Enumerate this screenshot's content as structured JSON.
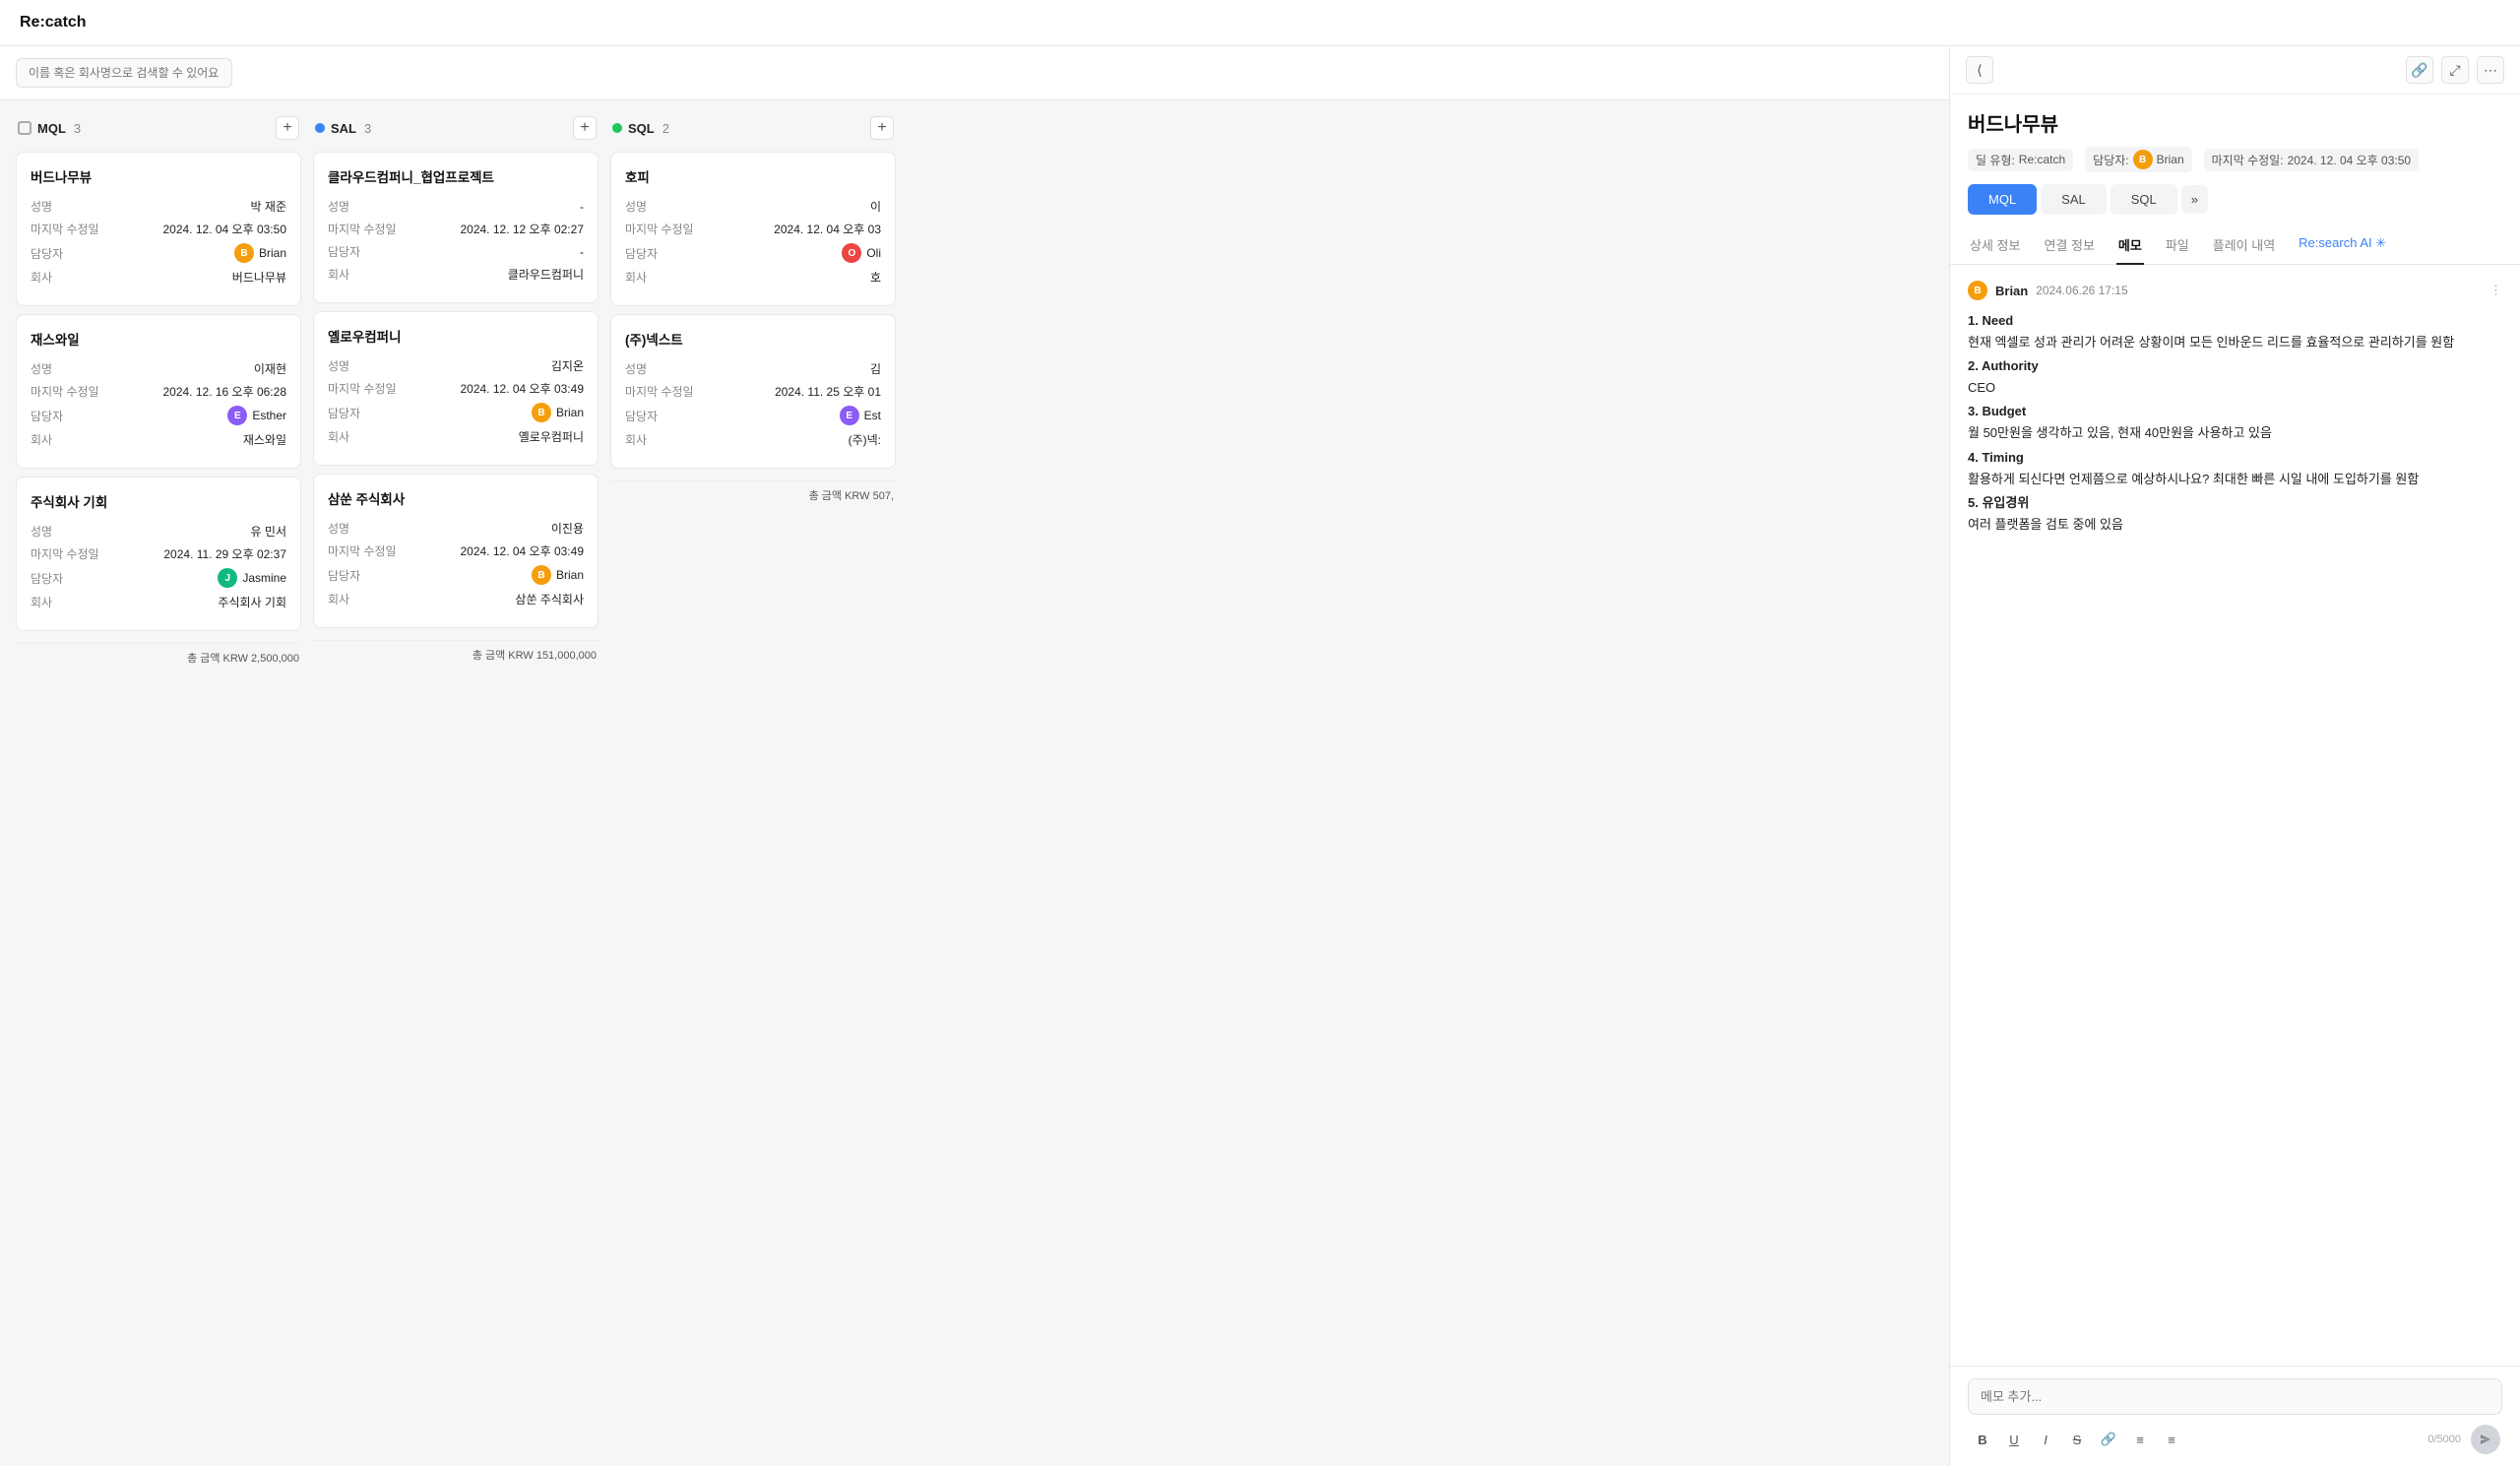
{
  "app": {
    "title": "Re:catch"
  },
  "search": {
    "placeholder": "이름 혹은 회사명으로 검색할 수 있어요."
  },
  "columns": [
    {
      "id": "mql",
      "label": "MQL",
      "count": 3,
      "dot_type": "outline",
      "total_label": "총 금액",
      "total": "KRW 2,500,000",
      "cards": [
        {
          "title": "버드나무뷰",
          "name_label": "성명",
          "name_value": "박 재준",
          "modified_label": "마지막 수정일",
          "modified_value": "2024. 12. 04 오후 03:50",
          "assignee_label": "담당자",
          "assignee_name": "Brian",
          "assignee_avatar": "B",
          "assignee_class": "av-brian",
          "company_label": "회사",
          "company_value": "버드나무뷰"
        },
        {
          "title": "재스와일",
          "name_label": "성명",
          "name_value": "이재현",
          "modified_label": "마지막 수정일",
          "modified_value": "2024. 12. 16 오후 06:28",
          "assignee_label": "담당자",
          "assignee_name": "Esther",
          "assignee_avatar": "E",
          "assignee_class": "av-esther",
          "company_label": "회사",
          "company_value": "재스와일"
        },
        {
          "title": "주식회사 기회",
          "name_label": "성명",
          "name_value": "유 민서",
          "modified_label": "마지막 수정일",
          "modified_value": "2024. 11. 29 오후 02:37",
          "assignee_label": "담당자",
          "assignee_name": "Jasmine",
          "assignee_avatar": "J",
          "assignee_class": "av-jasmine",
          "company_label": "회사",
          "company_value": "주식회사 기회"
        }
      ]
    },
    {
      "id": "sal",
      "label": "SAL",
      "count": 3,
      "dot_type": "blue",
      "total_label": "총 금액",
      "total": "KRW 151,000,000",
      "cards": [
        {
          "title": "클라우드컴퍼니_협업프로젝트",
          "name_label": "성명",
          "name_value": "-",
          "modified_label": "마지막 수정일",
          "modified_value": "2024. 12. 12 오후 02:27",
          "assignee_label": "담당자",
          "assignee_name": "-",
          "assignee_avatar": "",
          "assignee_class": "",
          "company_label": "회사",
          "company_value": "클라우드컴퍼니"
        },
        {
          "title": "옐로우컴퍼니",
          "name_label": "성명",
          "name_value": "김지온",
          "modified_label": "마지막 수정일",
          "modified_value": "2024. 12. 04 오후 03:49",
          "assignee_label": "담당자",
          "assignee_name": "Brian",
          "assignee_avatar": "B",
          "assignee_class": "av-brian",
          "company_label": "회사",
          "company_value": "옐로우컴퍼니"
        },
        {
          "title": "삼쑨 주식회사",
          "name_label": "성명",
          "name_value": "이진용",
          "modified_label": "마지막 수정일",
          "modified_value": "2024. 12. 04 오후 03:49",
          "assignee_label": "담당자",
          "assignee_name": "Brian",
          "assignee_avatar": "B",
          "assignee_class": "av-brian",
          "company_label": "회사",
          "company_value": "삼쑨 주식회사"
        }
      ]
    },
    {
      "id": "sql",
      "label": "SQL",
      "count": 2,
      "dot_type": "green",
      "total_label": "총 금액",
      "total": "KRW 507,",
      "cards": [
        {
          "title": "호피",
          "name_label": "성명",
          "name_value": "이",
          "modified_label": "마지막 수정일",
          "modified_value": "2024. 12. 04 오후 03",
          "assignee_label": "담당자",
          "assignee_name": "Oli",
          "assignee_avatar": "O",
          "assignee_class": "av-oli",
          "company_label": "회사",
          "company_value": "호"
        },
        {
          "title": "(주)넥스트",
          "name_label": "성명",
          "name_value": "김",
          "modified_label": "마지막 수정일",
          "modified_value": "2024. 11. 25 오후 01",
          "assignee_label": "담당자",
          "assignee_name": "Est",
          "assignee_avatar": "E",
          "assignee_class": "av-est",
          "company_label": "회사",
          "company_value": "(주)넥:"
        }
      ]
    }
  ],
  "detail": {
    "title": "버드나무뷰",
    "meta": {
      "deal_type_label": "딜 유형:",
      "deal_type_value": "Re:catch",
      "assignee_label": "담당자:",
      "assignee_name": "Brian",
      "assignee_avatar": "B",
      "modified_label": "마지막 수정일:",
      "modified_value": "2024. 12. 04 오후 03:50"
    },
    "stage_tabs": [
      {
        "label": "MQL",
        "active": true
      },
      {
        "label": "SAL",
        "active": false
      },
      {
        "label": "SQL",
        "active": false
      }
    ],
    "stage_more": "»",
    "nav_tabs": [
      {
        "label": "상세 정보",
        "active": false
      },
      {
        "label": "연결 정보",
        "active": false
      },
      {
        "label": "메모",
        "active": true
      },
      {
        "label": "파일",
        "active": false
      },
      {
        "label": "플레이 내역",
        "active": false
      },
      {
        "label": "Re:search AI ✳",
        "active": false,
        "special": true
      }
    ],
    "memo": {
      "author": "Brian",
      "author_avatar": "B",
      "timestamp": "2024.06.26  17:15",
      "content": [
        {
          "section": "1. Need",
          "text": "현재 엑셀로 성과 관리가 어려운 상황이며 모든 인바운드 리드를 효율적으로 관리하기를 원함"
        },
        {
          "section": "2. Authority",
          "text": "CEO"
        },
        {
          "section": "3. Budget",
          "text": "월 50만원을 생각하고 있음, 현재 40만원을 사용하고 있음"
        },
        {
          "section": "4. Timing",
          "text": "활용하게 되신다면 언제쯤으로 예상하시나요? 최대한 빠른 시일 내에 도입하기를 원함"
        },
        {
          "section": "5. 유입경위",
          "text": "여러 플랫폼을 검토 중에 있음"
        }
      ]
    },
    "memo_add_placeholder": "메모 추가...",
    "char_count": "0/5000"
  }
}
